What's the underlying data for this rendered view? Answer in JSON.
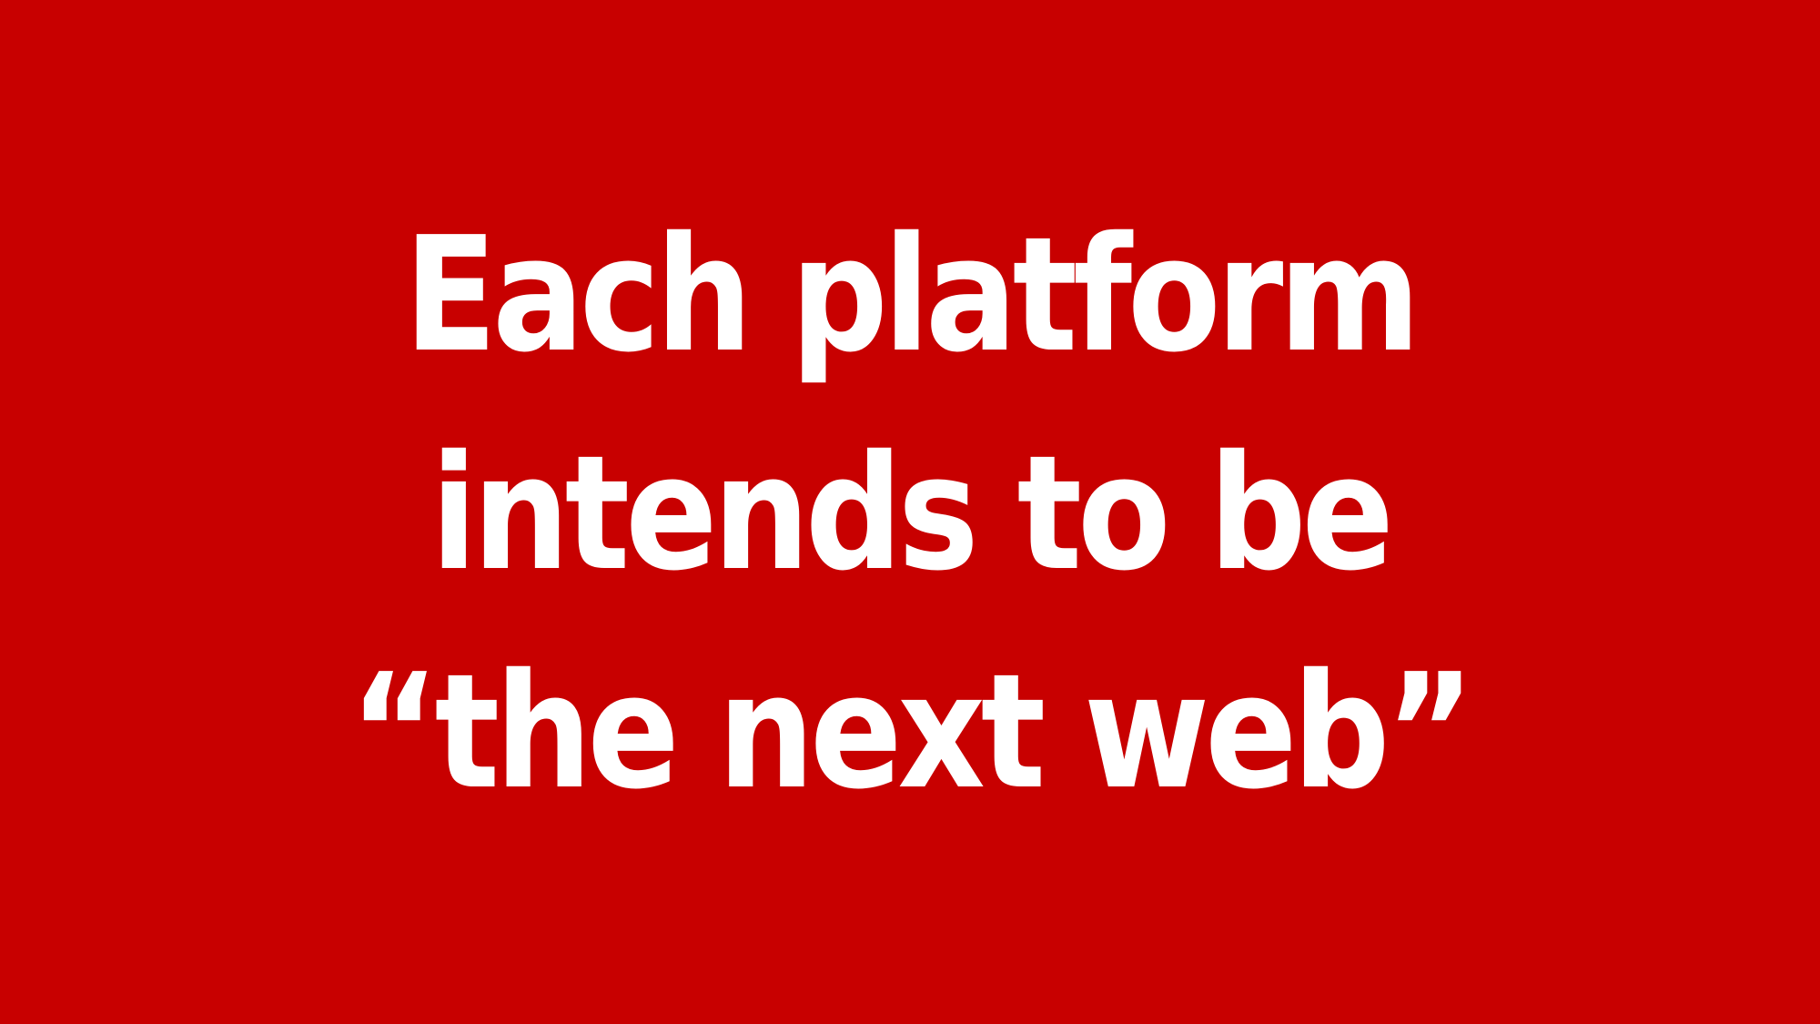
{
  "slide": {
    "lines": [
      "Each platform",
      "intends to be",
      "“the next web”"
    ]
  },
  "colors": {
    "background": "#c80000",
    "text": "#ffffff"
  }
}
